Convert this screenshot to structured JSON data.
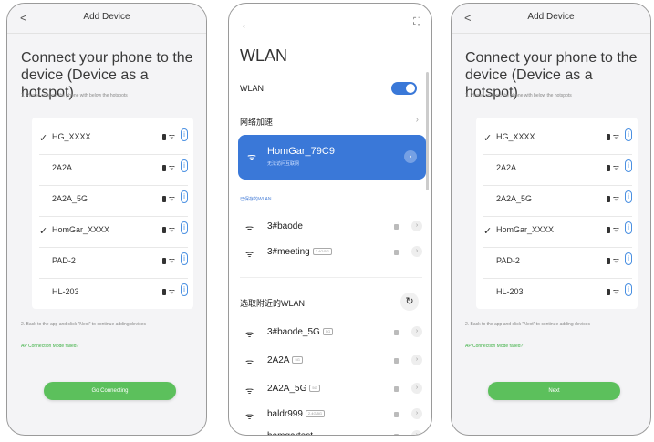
{
  "screen1": {
    "title": "Add Device",
    "back": "<",
    "headline": "Connect your phone to the device (Device as a hotspot)",
    "step1": "1. Please connect the phone with below the hotspots",
    "networks": [
      {
        "check": "✓",
        "name": "HG_XXXX"
      },
      {
        "check": "",
        "name": "2A2A"
      },
      {
        "check": "",
        "name": "2A2A_5G"
      },
      {
        "check": "✓",
        "name": "HomGar_XXXX"
      },
      {
        "check": "",
        "name": "PAD-2"
      },
      {
        "check": "",
        "name": "HL-203"
      }
    ],
    "step2": "2. Back to the app and click \"Next\" to continue adding devices",
    "failed": "AP Connection Mode failed?",
    "button": "Go Connecting"
  },
  "screen2": {
    "back": "←",
    "scan": "⛶",
    "title": "WLAN",
    "wlan_label": "WLAN",
    "accel_label": "网络加速",
    "accel_chevron": "›",
    "connected_name": "HomGar_79C9",
    "connected_sub": "无法访问互联网",
    "saved_label": "已保存的WLAN",
    "saved": [
      {
        "name": "3#baode",
        "tag": ""
      },
      {
        "name": "3#meeting",
        "tag": "2.4G/5G"
      }
    ],
    "nearby_label": "选取附近的WLAN",
    "refresh": "↻",
    "nearby": [
      {
        "name": "3#baode_5G",
        "tag": "5G"
      },
      {
        "name": "2A2A",
        "tag": "5G"
      },
      {
        "name": "2A2A_5G",
        "tag": "5G"
      },
      {
        "name": "baldr999",
        "tag": "2.4G/5G"
      },
      {
        "name": "homgartest",
        "tag": ""
      }
    ]
  },
  "screen3": {
    "title": "Add Device",
    "back": "<",
    "headline": "Connect your phone to the device (Device as a hotspot)",
    "step1": "1. Please connect the phone with below the hotspots",
    "networks": [
      {
        "check": "✓",
        "name": "HG_XXXX"
      },
      {
        "check": "",
        "name": "2A2A"
      },
      {
        "check": "",
        "name": "2A2A_5G"
      },
      {
        "check": "✓",
        "name": "HomGar_XXXX"
      },
      {
        "check": "",
        "name": "PAD-2"
      },
      {
        "check": "",
        "name": "HL-203"
      }
    ],
    "step2": "2. Back to the app and click \"Next\" to continue adding devices",
    "failed": "AP Connection Mode failed?",
    "button": "Next"
  },
  "colors": {
    "accent_green": "#5cc05c",
    "accent_blue": "#3a78d8",
    "info_blue": "#4a90e2"
  }
}
